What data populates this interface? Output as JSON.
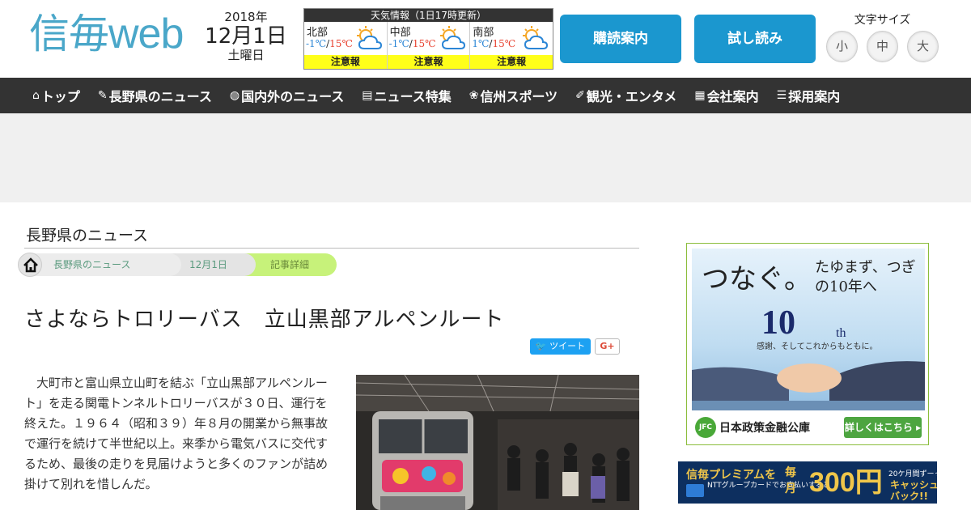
{
  "header": {
    "logo_kanji": "信毎",
    "logo_web": "web",
    "date_year": "2018年",
    "date_md": "12月1日",
    "date_weekday": "土曜日",
    "subscribe_label": "購読案内",
    "trial_label": "試し読み",
    "font_size_label": "文字サイズ",
    "font_sizes": [
      "小",
      "中",
      "大"
    ]
  },
  "weather": {
    "title": "天気情報（1日17時更新）",
    "regions": [
      {
        "name": "北部",
        "low": "-1℃",
        "high": "15℃",
        "alert": "注意報",
        "icon": "sun-cloud-icon"
      },
      {
        "name": "中部",
        "low": "-1℃",
        "high": "15℃",
        "alert": "注意報",
        "icon": "sun-cloud-icon"
      },
      {
        "name": "南部",
        "low": "1℃",
        "high": "15℃",
        "alert": "注意報",
        "icon": "sun-cloud-icon"
      }
    ],
    "low_color": "#2b86d6",
    "high_color": "#e8402e"
  },
  "nav": {
    "items": [
      {
        "label": "トップ",
        "icon": "home-icon"
      },
      {
        "label": "長野県のニュース",
        "icon": "pen-icon"
      },
      {
        "label": "国内外のニュース",
        "icon": "globe-icon"
      },
      {
        "label": "ニュース特集",
        "icon": "document-icon"
      },
      {
        "label": "信州スポーツ",
        "icon": "ball-icon"
      },
      {
        "label": "観光・エンタメ",
        "icon": "tag-icon"
      },
      {
        "label": "会社案内",
        "icon": "building-icon"
      },
      {
        "label": "採用案内",
        "icon": "list-icon"
      }
    ]
  },
  "article": {
    "section_title": "長野県のニュース",
    "breadcrumbs": [
      "長野県のニュース",
      "12月1日",
      "記事詳細"
    ],
    "headline": "さよならトロリーバス　立山黒部アルペンルート",
    "tweet_label": "ツイート",
    "gplus_label": "G+",
    "body": "　大町市と富山県立山町を結ぶ「立山黒部アルペンルート」を走る関電トンネルトロリーバスが３０日、運行を終えた。１９６４（昭和３９）年８月の開業から無事故で運行を続けて半世紀以上。来季から電気バスに交代するため、最後の走りを見届けようと多くのファンが詰め掛けて別れを惜しんだ。"
  },
  "side_ad_1": {
    "copy_main": "つなぐ。",
    "copy_sub": "たゆまず、つぎの10年へ",
    "anniv_num": "10",
    "anniv_suffix": "th",
    "tagline": "感謝、そしてこれからもともに。",
    "logo_text": "JFC",
    "org_name": "日本政策金融公庫",
    "cta": "詳しくはこちら ▸"
  },
  "side_ad_2": {
    "brand": "信毎プレミアムを",
    "card_note": "NTTグループカードでお支払いすると",
    "monthly": "毎月",
    "amount": "300円",
    "period_note": "20ケ月間ずーっと",
    "cashback": "キャッシュバック!!"
  }
}
